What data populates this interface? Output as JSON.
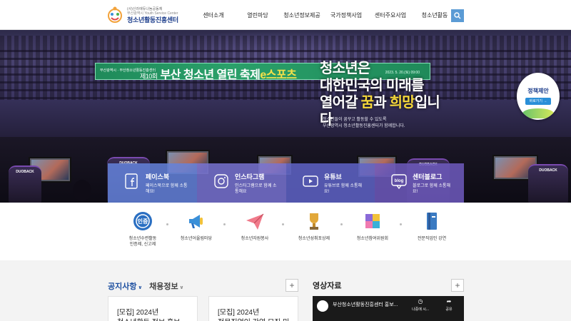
{
  "header": {
    "logo": {
      "org_line": "(사)신라에듀나눔공동체",
      "sub_line": "부산광역시 Youth Service Center",
      "name": "청소년활동진흥센터"
    },
    "nav": [
      "센터소개",
      "열린마당",
      "청소년정보제공",
      "국가정책사업",
      "센터주요사업",
      "청소년활동"
    ],
    "search_icon": "search-icon"
  },
  "hero": {
    "banner": {
      "org": "부산광역시 · 부산청소년활동진흥센터",
      "title_prefix": "제10회",
      "title_main": "부산 청소년 열린 축제",
      "title_highlight": "e스포츠",
      "date": "2023. 5. 20.(토) 09:00"
    },
    "headline_line1": "청소년은",
    "headline_line2": "대한민국의 미래를",
    "headline_line3_pre": "열어갈",
    "headline_line3_hl1": "꿈",
    "headline_line3_mid": "과",
    "headline_line3_hl2": "희망",
    "headline_line3_post": "입니다",
    "subline_1": "청소년들이 꿈꾸고 활동할 수 있도록",
    "subline_2": "부산광역시 청소년활동진흥센터가 함께합니다.",
    "chair_brand": "DUOBACK"
  },
  "proposal": {
    "title": "정책제안",
    "button": "바로가기 →"
  },
  "sns": [
    {
      "title": "페이스북",
      "desc": "페이스북으로 함께 소통해요!",
      "icon": "facebook-icon"
    },
    {
      "title": "인스타그램",
      "desc": "인스타그램으로 함께 소통해요",
      "icon": "instagram-icon"
    },
    {
      "title": "유튜브",
      "desc": "유튜브로 함께 소통해요!",
      "icon": "youtube-icon"
    },
    {
      "title": "센터블로그",
      "desc": "블로그로 함께 소통해요!",
      "icon": "blog-icon"
    }
  ],
  "quick_links": [
    {
      "label": "청소년수련활동\n인증제, 신고제",
      "icon": "certification-icon"
    },
    {
      "label": "청소년어울림마당",
      "icon": "megaphone-icon"
    },
    {
      "label": "청소년자원봉사",
      "icon": "paper-plane-icon"
    },
    {
      "label": "청소년성취포상제",
      "icon": "trophy-icon"
    },
    {
      "label": "청소년참여위원회",
      "icon": "puzzle-icon"
    },
    {
      "label": "전문직업인 강연",
      "icon": "book-icon"
    }
  ],
  "notice": {
    "tab_active": "공지사항",
    "tab_other": "채용정보",
    "cards": [
      "[모집] 2024년\n청소년활동 정보 홍보",
      "[모집] 2024년\n전문직업인 강연 모집 및"
    ]
  },
  "video": {
    "section_title": "영상자료",
    "title": "부산청소년활동진흥센터 홍보...",
    "watch_later": "나중에 시...",
    "share": "공유"
  },
  "colors": {
    "brand": "#1d3e8c",
    "search": "#5b9bd5",
    "tab_active": "#1d4fa0"
  }
}
